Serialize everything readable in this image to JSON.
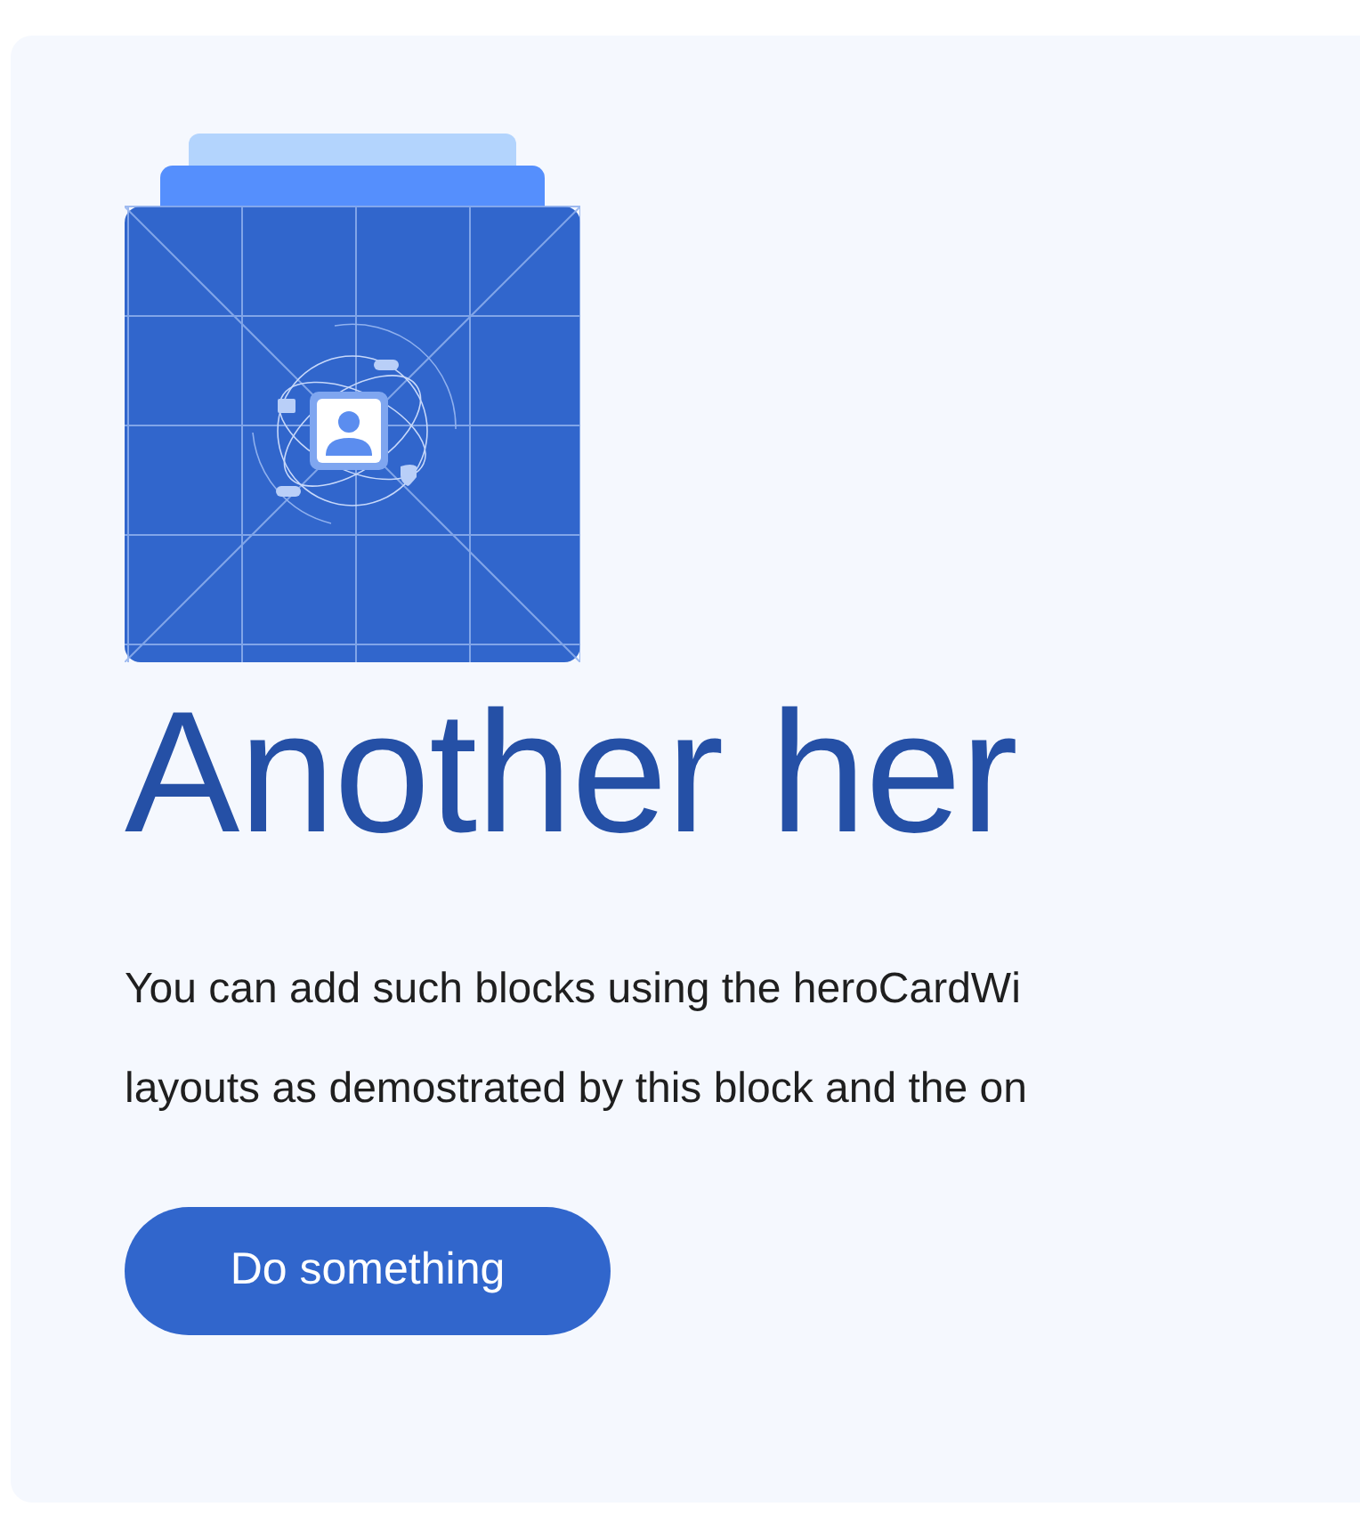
{
  "hero": {
    "title": "Another her",
    "body_lines": [
      "You can add such blocks using the heroCardWi",
      "layouts as demostrated by this block and the on"
    ],
    "button": "Do something"
  }
}
